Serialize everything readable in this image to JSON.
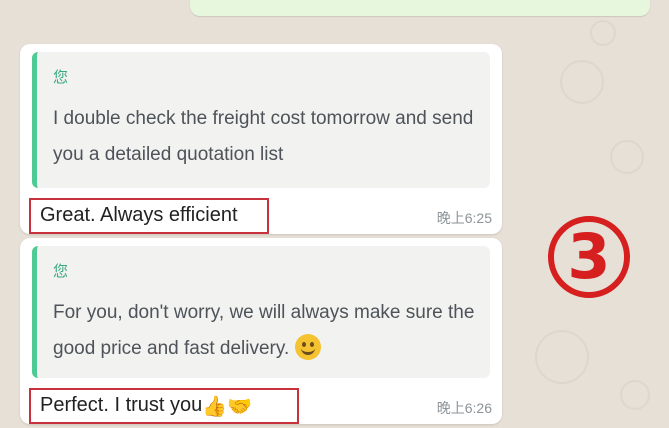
{
  "top_bubble": {
    "meta": ""
  },
  "messages": [
    {
      "quote_author": "您",
      "quote_text": "I double check the freight cost tomorrow and send you a detailed quotation list",
      "reply": "Great. Always efficient",
      "time": "晚上6:25"
    },
    {
      "quote_author": "您",
      "quote_text": "For you, don't worry, we will always make sure the good price and fast delivery.",
      "quote_emoji": "smiling-face-emoji",
      "reply": "Perfect. I trust you",
      "reply_emojis": [
        "thumbs-up-emoji",
        "handshake-emoji"
      ],
      "time": "晚上6:26"
    }
  ],
  "annotation": "③",
  "colors": {
    "highlight_box": "#c8323d",
    "annotation": "#d61f1f",
    "quote_bar": "#4ecb95"
  }
}
